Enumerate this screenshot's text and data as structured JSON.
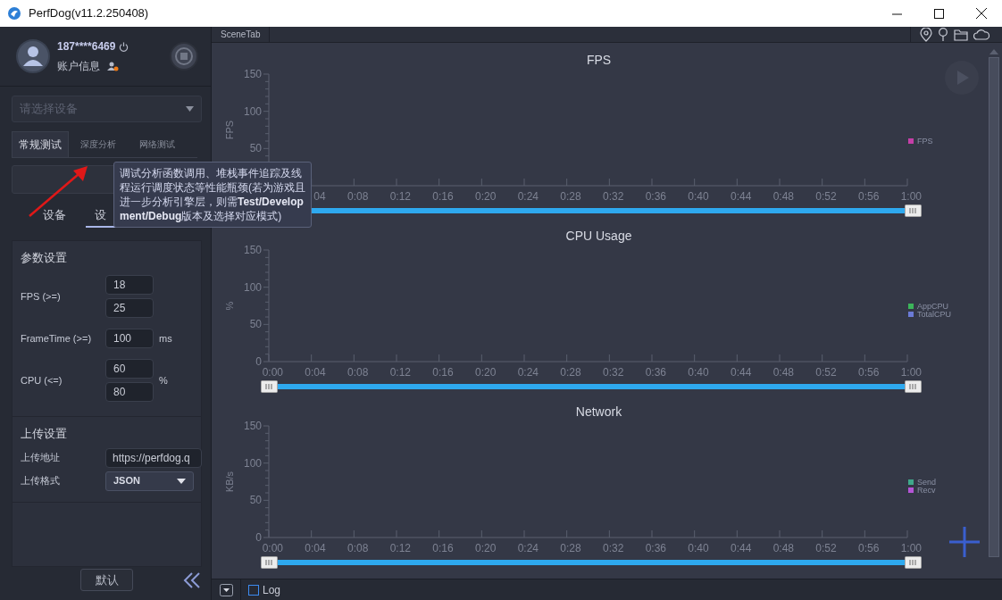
{
  "window": {
    "title": "PerfDog(v11.2.250408)"
  },
  "account": {
    "phone": "187****6469",
    "label": "账户信息"
  },
  "device_select": {
    "placeholder": "请选择设备"
  },
  "tabs": [
    {
      "label": "常规测试",
      "selected": true
    },
    {
      "label": "深度分析",
      "selected": false
    },
    {
      "label": "网络测试",
      "selected": false
    }
  ],
  "sub_tabs": [
    {
      "label": "设备",
      "selected": false
    },
    {
      "label": "设",
      "selected": true
    }
  ],
  "tooltip": {
    "text": "调试分析函数调用、堆栈事件追踪及线程运行调度状态等性能瓶颈(若为游戏且进一步分析引擎层，则需**Test/Development/Debug**版本及选择对应模式)"
  },
  "param_settings": {
    "title": "参数设置",
    "rows": [
      {
        "label": "FPS (>=)",
        "values": [
          "18",
          "25"
        ]
      },
      {
        "label": "FrameTime (>=)",
        "values": [
          "100"
        ],
        "unit": "ms"
      },
      {
        "label": "CPU (<=)",
        "values": [
          "60",
          "80"
        ],
        "unit": "%"
      }
    ]
  },
  "upload_settings": {
    "title": "上传设置",
    "rows": [
      {
        "kind": "input",
        "label": "上传地址",
        "value": "https://perfdog.q"
      },
      {
        "kind": "select",
        "label": "上传格式",
        "value": "JSON"
      }
    ]
  },
  "default_button": "默认",
  "scene_tab": "SceneTab",
  "charts": [
    {
      "chart_data": {
        "type": "line",
        "title": "FPS",
        "ylabel": "FPS",
        "ylim": [
          0,
          150
        ],
        "yticks": [
          50,
          100,
          150
        ],
        "categories": [
          null,
          "04",
          "0:08",
          "0:12",
          "0:16",
          "0:20",
          "0:24",
          "0:28",
          "0:32",
          "0:36",
          "0:40",
          "0:44",
          "0:48",
          "0:52",
          "0:56",
          "1:00"
        ],
        "series": [
          {
            "name": "FPS",
            "color": "#c53fa8",
            "values": [
              null,
              null,
              null,
              null,
              null,
              null,
              null,
              null,
              null,
              null,
              null,
              null,
              null,
              null,
              null,
              null
            ]
          }
        ]
      }
    },
    {
      "chart_data": {
        "type": "line",
        "title": "CPU Usage",
        "ylabel": "%",
        "ylim": [
          0,
          150
        ],
        "yticks": [
          0,
          50,
          100,
          150
        ],
        "categories": [
          "0:00",
          "0:04",
          "0:08",
          "0:12",
          "0:16",
          "0:20",
          "0:24",
          "0:28",
          "0:32",
          "0:36",
          "0:40",
          "0:44",
          "0:48",
          "0:52",
          "0:56",
          "1:00"
        ],
        "series": [
          {
            "name": "AppCPU",
            "color": "#3cb45a",
            "values": [
              null,
              null,
              null,
              null,
              null,
              null,
              null,
              null,
              null,
              null,
              null,
              null,
              null,
              null,
              null,
              null
            ]
          },
          {
            "name": "TotalCPU",
            "color": "#6b7bd6",
            "values": [
              null,
              null,
              null,
              null,
              null,
              null,
              null,
              null,
              null,
              null,
              null,
              null,
              null,
              null,
              null,
              null
            ]
          }
        ]
      }
    },
    {
      "chart_data": {
        "type": "line",
        "title": "Network",
        "ylabel": "KB/s",
        "ylim": [
          0,
          150
        ],
        "yticks": [
          0,
          50,
          100,
          150
        ],
        "categories": [
          "0:00",
          "0:04",
          "0:08",
          "0:12",
          "0:16",
          "0:20",
          "0:24",
          "0:28",
          "0:32",
          "0:36",
          "0:40",
          "0:44",
          "0:48",
          "0:52",
          "0:56",
          "1:00"
        ],
        "series": [
          {
            "name": "Send",
            "color": "#3fa88a",
            "values": [
              null,
              null,
              null,
              null,
              null,
              null,
              null,
              null,
              null,
              null,
              null,
              null,
              null,
              null,
              null,
              null
            ]
          },
          {
            "name": "Recv",
            "color": "#b455d6",
            "values": [
              null,
              null,
              null,
              null,
              null,
              null,
              null,
              null,
              null,
              null,
              null,
              null,
              null,
              null,
              null,
              null
            ]
          }
        ]
      }
    }
  ],
  "log": {
    "label": "Log",
    "checked": false
  }
}
